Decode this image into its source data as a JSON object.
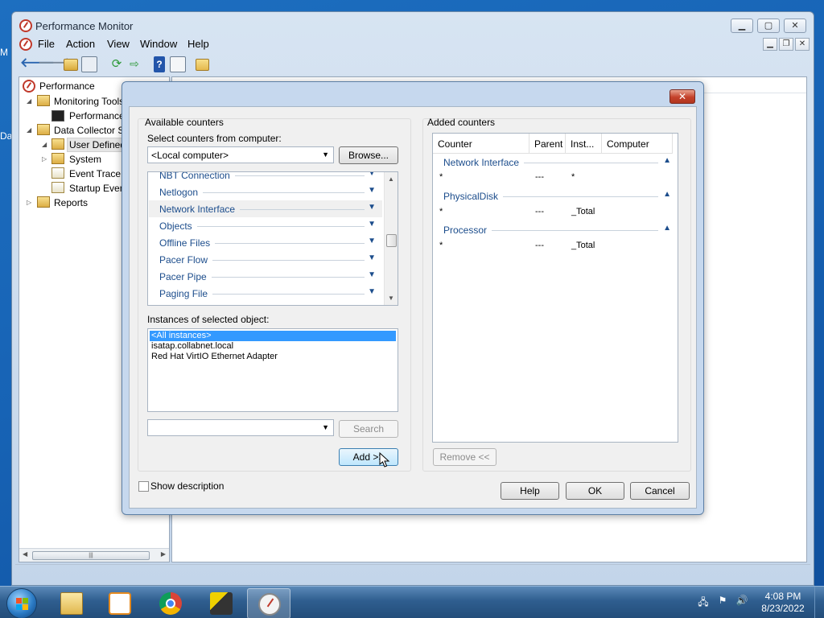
{
  "desktop": {
    "edge_texts": [
      "M",
      "Da"
    ]
  },
  "window": {
    "title": "Performance Monitor",
    "menu": [
      "File",
      "Action",
      "View",
      "Window",
      "Help"
    ],
    "caption_buttons": [
      "minimize",
      "maximize",
      "close"
    ],
    "mdi_buttons": [
      "minimize",
      "restore",
      "close"
    ]
  },
  "tree": {
    "items": [
      {
        "label": "Performance",
        "icon": "perfmon-icon"
      },
      {
        "label": "Monitoring Tools",
        "icon": "monitoring-tools-icon"
      },
      {
        "label": "Performance Monitor",
        "icon": "performance-monitor-icon"
      },
      {
        "label": "Data Collector Sets",
        "icon": "data-collector-sets-icon"
      },
      {
        "label": "User Defined",
        "icon": "user-defined-icon"
      },
      {
        "label": "System",
        "icon": "system-folder-icon"
      },
      {
        "label": "Event Trace Sessions",
        "icon": "event-trace-icon"
      },
      {
        "label": "Startup Event Trace Sessions",
        "icon": "startup-event-icon"
      },
      {
        "label": "Reports",
        "icon": "reports-icon"
      }
    ]
  },
  "dialog": {
    "available_title": "Available counters",
    "select_computer_label": "Select counters from computer:",
    "computer_value": "<Local computer>",
    "browse_label": "Browse...",
    "objects": [
      {
        "label": "NBT Connection",
        "selected": false
      },
      {
        "label": "Netlogon",
        "selected": false
      },
      {
        "label": "Network Interface",
        "selected": true
      },
      {
        "label": "Objects",
        "selected": false
      },
      {
        "label": "Offline Files",
        "selected": false
      },
      {
        "label": "Pacer Flow",
        "selected": false
      },
      {
        "label": "Pacer Pipe",
        "selected": false
      },
      {
        "label": "Paging File",
        "selected": false
      }
    ],
    "instances_label": "Instances of selected object:",
    "instances": [
      {
        "label": "<All instances>",
        "selected": true
      },
      {
        "label": "isatap.collabnet.local",
        "selected": false
      },
      {
        "label": "Red Hat VirtIO Ethernet Adapter",
        "selected": false
      }
    ],
    "search_value": "",
    "search_label": "Search",
    "add_label": "Add >>",
    "added_title": "Added counters",
    "columns": [
      "Counter",
      "Parent",
      "Inst...",
      "Computer"
    ],
    "added_groups": [
      {
        "name": "Network Interface",
        "counter": "*",
        "parent": "---",
        "instance": "*",
        "computer": ""
      },
      {
        "name": "PhysicalDisk",
        "counter": "*",
        "parent": "---",
        "instance": "_Total",
        "computer": ""
      },
      {
        "name": "Processor",
        "counter": "*",
        "parent": "---",
        "instance": "_Total",
        "computer": ""
      }
    ],
    "remove_label": "Remove <<",
    "show_description_label": "Show description",
    "show_description_checked": false,
    "help_label": "Help",
    "ok_label": "OK",
    "cancel_label": "Cancel",
    "close_glyph": "✕"
  },
  "taskbar": {
    "apps": [
      {
        "name": "windows-explorer",
        "active": false
      },
      {
        "name": "windows-media-player",
        "active": false
      },
      {
        "name": "google-chrome",
        "active": false
      },
      {
        "name": "tools-app",
        "active": false
      },
      {
        "name": "performance-monitor",
        "active": true
      }
    ],
    "clock_time": "4:08 PM",
    "clock_date": "8/23/2022"
  },
  "colors": {
    "desktop": "#1763b5",
    "selection": "#3399ff",
    "object_text": "#1c4d8c"
  }
}
